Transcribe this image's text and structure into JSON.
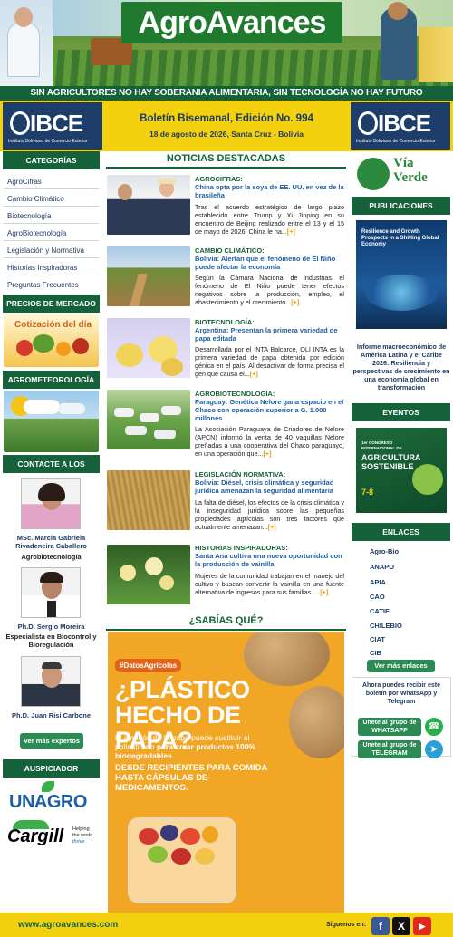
{
  "brand": {
    "logo": "AgroAvances",
    "slogan": "SIN AGRICULTORES NO HAY SOBERANIA ALIMENTARIA, SIN TECNOLOGÍA NO HAY FUTURO"
  },
  "ibce": {
    "word": "IBCE",
    "sub": "Instituto Boliviano de Comercio Exterior"
  },
  "header": {
    "boletin": "Boletín Bisemanal, Edición No. 994",
    "fecha": "18 de agosto de 2026, Santa Cruz - Bolivia"
  },
  "left": {
    "categorias_title": "CATEGORÍAS",
    "categorias": [
      "AgroCifras",
      "Cambio Climático",
      "Biotecnología",
      "AgroBiotecnología",
      "Legislación y Normativa",
      "Historias Inspiradoras",
      "Preguntas Frecuentes"
    ],
    "precios_title": "PRECIOS DE MERCADO",
    "cotizacion": "Cotización del día",
    "agromet_title": "AGROMETEOROLOGÍA",
    "contacte_title": "CONTACTE A LOS EXPERTOS",
    "experts": [
      {
        "name": "MSc. Marcia Gabriela Rivadeneira Caballero",
        "area": "Agrobiotecnología"
      },
      {
        "name": "Ph.D. Sergio Moreira",
        "area": "Especialista en Biocontrol y Bioregulación"
      },
      {
        "name": "Ph.D. Juan Risi Carbone",
        "area": ""
      }
    ],
    "ver_expertos": "Ver más expertos",
    "auspiciador_title": "AUSPICIADOR",
    "sponsor1": "UNAGRO",
    "sponsor2": "Cargill",
    "sponsor2_tag": [
      "Helping",
      "the world",
      "thrive"
    ]
  },
  "center": {
    "title": "NOTICIAS DESTACADAS",
    "news": [
      {
        "cat": "AGROCIFRAS:",
        "title": "China opta por la soya de EE. UU. en vez de la brasileña",
        "body": "Tras el acuerdo estratégico de largo plazo establecido entre Trump y Xi Jinping en su encuentro de Beijing realizado entre el 13 y el 15 de mayo de 2026, China le ha..."
      },
      {
        "cat": "CAMBIO CLIMÁTICO:",
        "title": "Bolivia: Alertan que el fenómeno de El Niño puede afectar la economía",
        "body": "Según la Cámara Nacional de Industrias, el fenómeno de El Niño puede tener efectos negativos sobre la producción, empleo, el abastecimiento y el crecimiento..."
      },
      {
        "cat": "BIOTECNOLOGÍA:",
        "title": "Argentina: Presentan la primera variedad de papa editada",
        "body": "Desarrollada por el INTA Balcarce, OLI INTA es la primera variedad de papa obtenida por edición génica en el país. Al desactivar de forma precisa el gen que causa el..."
      },
      {
        "cat": "AGROBIOTECNOLOGÍA:",
        "title": "Paraguay: Genética Nelore gana espacio en el Chaco con operación superior a G. 1.000 millones",
        "body": "La Asociación Paraguaya de Criadores de Nelore (APCN) informó la venta de 40 vaquillas Nelore preñadas a una cooperativa del Chaco paraguayo, en una operación que..."
      },
      {
        "cat": "LEGISLACIÓN NORMATIVA:",
        "title": "Bolivia: Diésel, crisis climática y seguridad jurídica amenazan la seguridad alimentaria",
        "body": "La falta de diésel, los efectos de la crisis climática y la inseguridad jurídica sobre las pequeñas propiedades agrícolas son tres factores que actualmente amenazan..."
      },
      {
        "cat": "HISTORIAS INSPIRADORAS:",
        "title": "Santa Ana cultiva una nueva oportunidad con la producción de vainilla",
        "body": "Mujeres de la comunidad trabajan en el manejo del cultivo y buscan convertir la vainilla en una fuente alternativa de ingresos para sus familias. ..."
      }
    ],
    "more_mark": "[+]",
    "sabias": "¿SABÍAS QUÉ?",
    "promo": {
      "tag": "#DatosAgrícolas",
      "big": "¿PLÁSTICO HECHO DE PAPA?",
      "sub1a": "El almidón de la papa puede sustituir al poliestireno ",
      "sub1b": "para crear productos 100% biodegradables.",
      "sub2": "DESDE RECIPIENTES PARA COMIDA HASTA CÁPSULAS DE MEDICAMENTOS."
    }
  },
  "right": {
    "via_verde_1": "Vía",
    "via_verde_2": "Verde",
    "publicaciones_title": "PUBLICACIONES",
    "pub_cover_title": "Resilience and Growth Prospects in a Shifting Global Economy",
    "pub_caption": "Informe macroeconómico de América Latina y el Caribe 2026: Resiliencia y perspectivas de crecimiento en una economía global en transformación",
    "eventos_title": "EVENTOS",
    "evento_line1": "1er CONGRESO INTERNACIONAL DE",
    "evento_line2": "AGRICULTURA SOSTENIBLE",
    "evento_date": "7-8",
    "enlaces_title": "ENLACES",
    "enlaces": [
      "Agro-Bio",
      "ANAPO",
      "APIA",
      "CAO",
      "CATIE",
      "CHILEBIO",
      "CIAT",
      "CIB"
    ],
    "ver_enlaces": "Ver más enlaces",
    "whatsapp_text": "Ahora puedes recibir este boletín por WhatsApp y Telegram",
    "whatsapp_btn": "Unete al grupo de WHATSAPP",
    "telegram_btn": "Unete al grupo de TELEGRAM"
  },
  "footer": {
    "url": "www.agroavances.com",
    "follow": "Síguenos en:",
    "social": [
      "f",
      "X",
      "▶"
    ]
  },
  "colors": {
    "green": "#14613a",
    "yellow": "#f4d10f",
    "navy": "#1d3d6b",
    "link": "#1d5fa4"
  }
}
